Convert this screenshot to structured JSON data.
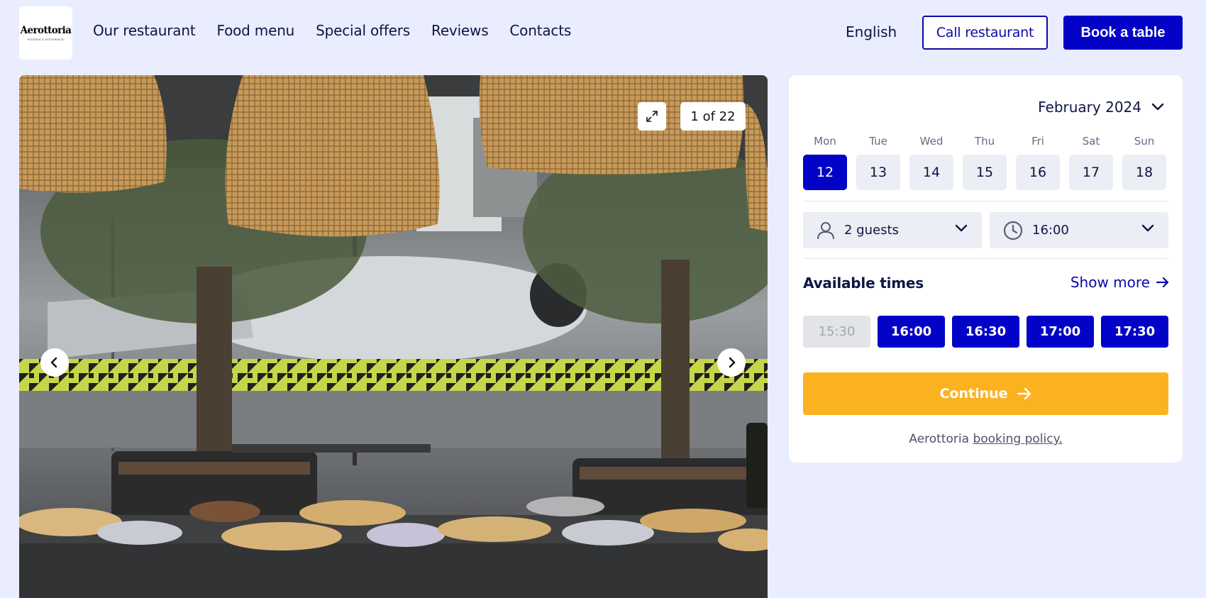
{
  "header": {
    "logo": {
      "name": "Aerottoria",
      "tagline": "PIZZERIA & RISTORANTE"
    },
    "nav": [
      "Our restaurant",
      "Food menu",
      "Special offers",
      "Reviews",
      "Contacts"
    ],
    "language": "English",
    "call_label": "Call restaurant",
    "book_label": "Book a table"
  },
  "gallery": {
    "counter": "1 of 22",
    "icons": {
      "expand": "expand-icon",
      "prev": "chevron-left-icon",
      "next": "chevron-right-icon"
    }
  },
  "booking": {
    "month": "February 2024",
    "weekdays": [
      "Mon",
      "Tue",
      "Wed",
      "Thu",
      "Fri",
      "Sat",
      "Sun"
    ],
    "days": [
      "12",
      "13",
      "14",
      "15",
      "16",
      "17",
      "18"
    ],
    "selected_day": "12",
    "guests": "2 guests",
    "time": "16:00",
    "available_title": "Available times",
    "show_more": "Show more",
    "slots": [
      {
        "time": "15:30",
        "available": false
      },
      {
        "time": "16:00",
        "available": true
      },
      {
        "time": "16:30",
        "available": true
      },
      {
        "time": "17:00",
        "available": true
      },
      {
        "time": "17:30",
        "available": true
      }
    ],
    "continue_label": "Continue",
    "policy_prefix": "Aerottoria",
    "policy_link": "booking policy."
  },
  "colors": {
    "page_bg": "#eaedfd",
    "primary": "#0303c7",
    "accent_yellow": "#fbb221",
    "text": "#0f1544"
  }
}
